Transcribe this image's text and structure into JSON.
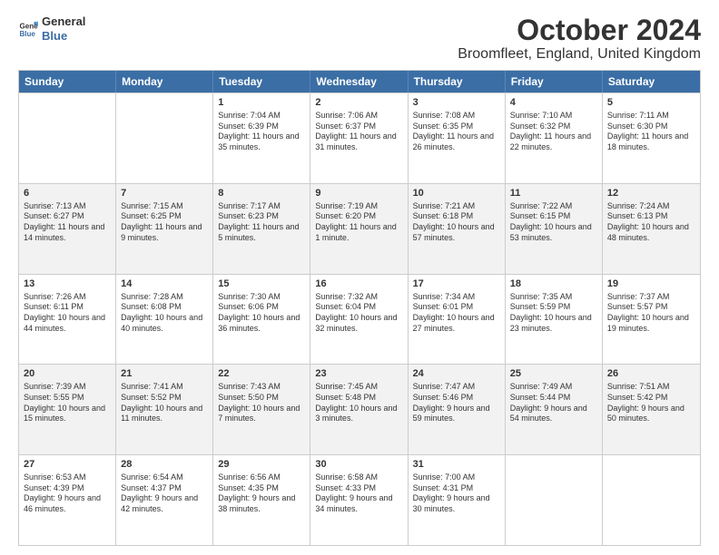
{
  "header": {
    "logo_general": "General",
    "logo_blue": "Blue",
    "month_title": "October 2024",
    "location": "Broomfleet, England, United Kingdom"
  },
  "days_of_week": [
    "Sunday",
    "Monday",
    "Tuesday",
    "Wednesday",
    "Thursday",
    "Friday",
    "Saturday"
  ],
  "weeks": [
    [
      {
        "day": "",
        "text": ""
      },
      {
        "day": "",
        "text": ""
      },
      {
        "day": "1",
        "text": "Sunrise: 7:04 AM\nSunset: 6:39 PM\nDaylight: 11 hours and 35 minutes."
      },
      {
        "day": "2",
        "text": "Sunrise: 7:06 AM\nSunset: 6:37 PM\nDaylight: 11 hours and 31 minutes."
      },
      {
        "day": "3",
        "text": "Sunrise: 7:08 AM\nSunset: 6:35 PM\nDaylight: 11 hours and 26 minutes."
      },
      {
        "day": "4",
        "text": "Sunrise: 7:10 AM\nSunset: 6:32 PM\nDaylight: 11 hours and 22 minutes."
      },
      {
        "day": "5",
        "text": "Sunrise: 7:11 AM\nSunset: 6:30 PM\nDaylight: 11 hours and 18 minutes."
      }
    ],
    [
      {
        "day": "6",
        "text": "Sunrise: 7:13 AM\nSunset: 6:27 PM\nDaylight: 11 hours and 14 minutes."
      },
      {
        "day": "7",
        "text": "Sunrise: 7:15 AM\nSunset: 6:25 PM\nDaylight: 11 hours and 9 minutes."
      },
      {
        "day": "8",
        "text": "Sunrise: 7:17 AM\nSunset: 6:23 PM\nDaylight: 11 hours and 5 minutes."
      },
      {
        "day": "9",
        "text": "Sunrise: 7:19 AM\nSunset: 6:20 PM\nDaylight: 11 hours and 1 minute."
      },
      {
        "day": "10",
        "text": "Sunrise: 7:21 AM\nSunset: 6:18 PM\nDaylight: 10 hours and 57 minutes."
      },
      {
        "day": "11",
        "text": "Sunrise: 7:22 AM\nSunset: 6:15 PM\nDaylight: 10 hours and 53 minutes."
      },
      {
        "day": "12",
        "text": "Sunrise: 7:24 AM\nSunset: 6:13 PM\nDaylight: 10 hours and 48 minutes."
      }
    ],
    [
      {
        "day": "13",
        "text": "Sunrise: 7:26 AM\nSunset: 6:11 PM\nDaylight: 10 hours and 44 minutes."
      },
      {
        "day": "14",
        "text": "Sunrise: 7:28 AM\nSunset: 6:08 PM\nDaylight: 10 hours and 40 minutes."
      },
      {
        "day": "15",
        "text": "Sunrise: 7:30 AM\nSunset: 6:06 PM\nDaylight: 10 hours and 36 minutes."
      },
      {
        "day": "16",
        "text": "Sunrise: 7:32 AM\nSunset: 6:04 PM\nDaylight: 10 hours and 32 minutes."
      },
      {
        "day": "17",
        "text": "Sunrise: 7:34 AM\nSunset: 6:01 PM\nDaylight: 10 hours and 27 minutes."
      },
      {
        "day": "18",
        "text": "Sunrise: 7:35 AM\nSunset: 5:59 PM\nDaylight: 10 hours and 23 minutes."
      },
      {
        "day": "19",
        "text": "Sunrise: 7:37 AM\nSunset: 5:57 PM\nDaylight: 10 hours and 19 minutes."
      }
    ],
    [
      {
        "day": "20",
        "text": "Sunrise: 7:39 AM\nSunset: 5:55 PM\nDaylight: 10 hours and 15 minutes."
      },
      {
        "day": "21",
        "text": "Sunrise: 7:41 AM\nSunset: 5:52 PM\nDaylight: 10 hours and 11 minutes."
      },
      {
        "day": "22",
        "text": "Sunrise: 7:43 AM\nSunset: 5:50 PM\nDaylight: 10 hours and 7 minutes."
      },
      {
        "day": "23",
        "text": "Sunrise: 7:45 AM\nSunset: 5:48 PM\nDaylight: 10 hours and 3 minutes."
      },
      {
        "day": "24",
        "text": "Sunrise: 7:47 AM\nSunset: 5:46 PM\nDaylight: 9 hours and 59 minutes."
      },
      {
        "day": "25",
        "text": "Sunrise: 7:49 AM\nSunset: 5:44 PM\nDaylight: 9 hours and 54 minutes."
      },
      {
        "day": "26",
        "text": "Sunrise: 7:51 AM\nSunset: 5:42 PM\nDaylight: 9 hours and 50 minutes."
      }
    ],
    [
      {
        "day": "27",
        "text": "Sunrise: 6:53 AM\nSunset: 4:39 PM\nDaylight: 9 hours and 46 minutes."
      },
      {
        "day": "28",
        "text": "Sunrise: 6:54 AM\nSunset: 4:37 PM\nDaylight: 9 hours and 42 minutes."
      },
      {
        "day": "29",
        "text": "Sunrise: 6:56 AM\nSunset: 4:35 PM\nDaylight: 9 hours and 38 minutes."
      },
      {
        "day": "30",
        "text": "Sunrise: 6:58 AM\nSunset: 4:33 PM\nDaylight: 9 hours and 34 minutes."
      },
      {
        "day": "31",
        "text": "Sunrise: 7:00 AM\nSunset: 4:31 PM\nDaylight: 9 hours and 30 minutes."
      },
      {
        "day": "",
        "text": ""
      },
      {
        "day": "",
        "text": ""
      }
    ]
  ]
}
